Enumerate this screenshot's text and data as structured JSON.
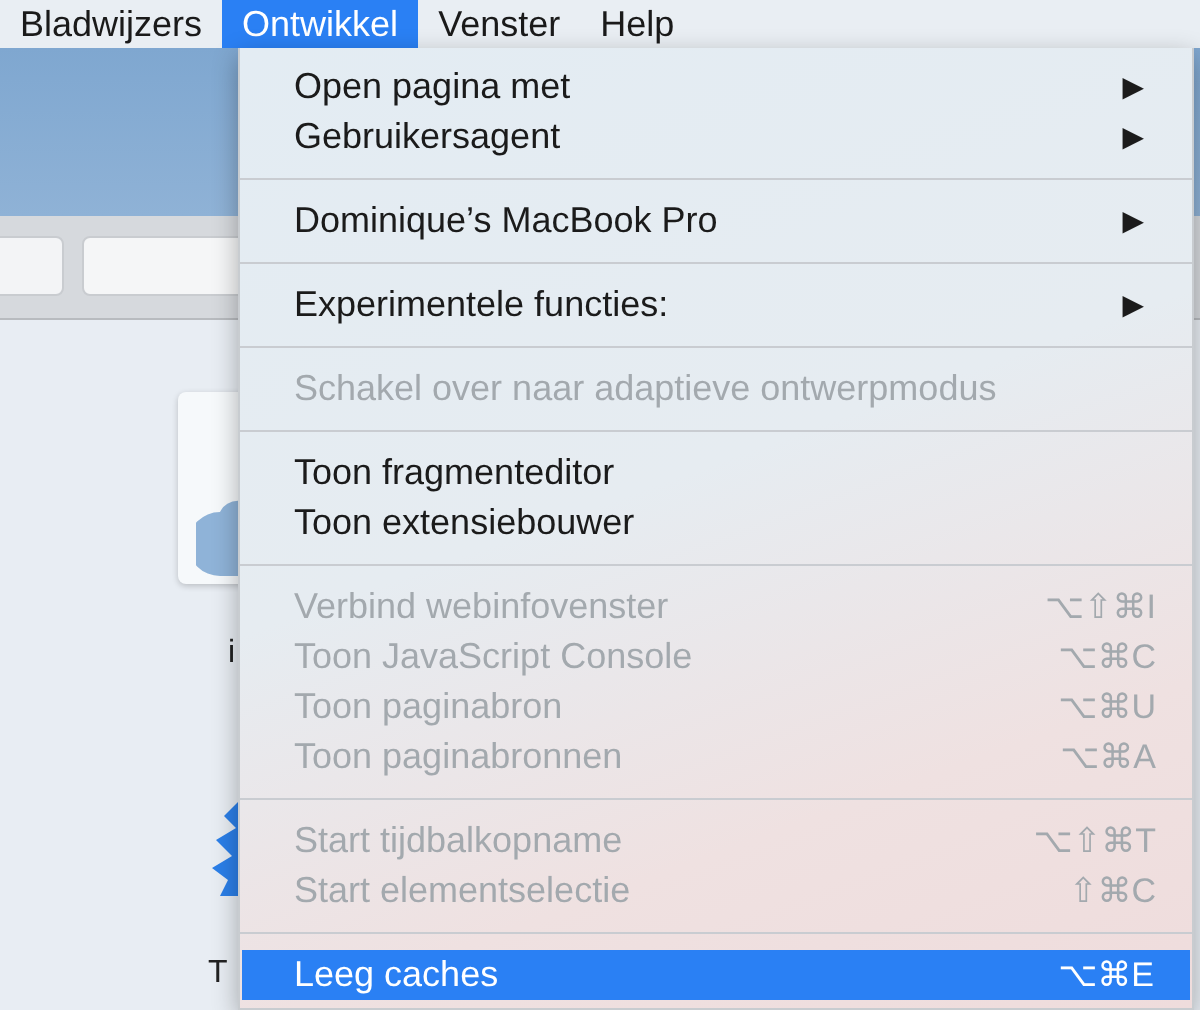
{
  "menubar": [
    {
      "label": "Bladwijzers",
      "selected": false
    },
    {
      "label": "Ontwikkel",
      "selected": true
    },
    {
      "label": "Venster",
      "selected": false
    },
    {
      "label": "Help",
      "selected": false
    }
  ],
  "background_window": {
    "labels": [
      "i",
      "T"
    ]
  },
  "menu": {
    "items": [
      {
        "kind": "item",
        "label": "Open pagina met",
        "arrow": "▶",
        "disabled": false,
        "selected": false
      },
      {
        "kind": "item",
        "label": "Gebruikersagent",
        "arrow": "▶",
        "disabled": false,
        "selected": false
      },
      {
        "kind": "separator"
      },
      {
        "kind": "item",
        "label": "Dominique’s MacBook Pro",
        "arrow": "▶",
        "disabled": false,
        "selected": false
      },
      {
        "kind": "separator"
      },
      {
        "kind": "item",
        "label": "Experimentele functies:",
        "arrow": "▶",
        "disabled": false,
        "selected": false
      },
      {
        "kind": "separator"
      },
      {
        "kind": "item",
        "label": "Schakel over naar adaptieve ontwerpmodus",
        "disabled": true,
        "selected": false
      },
      {
        "kind": "separator"
      },
      {
        "kind": "item",
        "label": "Toon fragmenteditor",
        "disabled": false,
        "selected": false
      },
      {
        "kind": "item",
        "label": "Toon extensiebouwer",
        "disabled": false,
        "selected": false
      },
      {
        "kind": "separator"
      },
      {
        "kind": "item",
        "label": "Verbind webinfovenster",
        "shortcut": "⌥⇧⌘I",
        "disabled": true,
        "selected": false
      },
      {
        "kind": "item",
        "label": "Toon JavaScript Console",
        "shortcut": "⌥⌘C",
        "disabled": true,
        "selected": false
      },
      {
        "kind": "item",
        "label": "Toon paginabron",
        "shortcut": "⌥⌘U",
        "disabled": true,
        "selected": false
      },
      {
        "kind": "item",
        "label": "Toon paginabronnen",
        "shortcut": "⌥⌘A",
        "disabled": true,
        "selected": false
      },
      {
        "kind": "separator"
      },
      {
        "kind": "item",
        "label": "Start tijdbalkopname",
        "shortcut": "⌥⇧⌘T",
        "disabled": true,
        "selected": false
      },
      {
        "kind": "item",
        "label": "Start elementselectie",
        "shortcut": "⇧⌘C",
        "disabled": true,
        "selected": false
      },
      {
        "kind": "separator"
      },
      {
        "kind": "item",
        "label": "Leeg caches",
        "shortcut": "⌥⌘E",
        "disabled": false,
        "selected": true
      }
    ]
  }
}
